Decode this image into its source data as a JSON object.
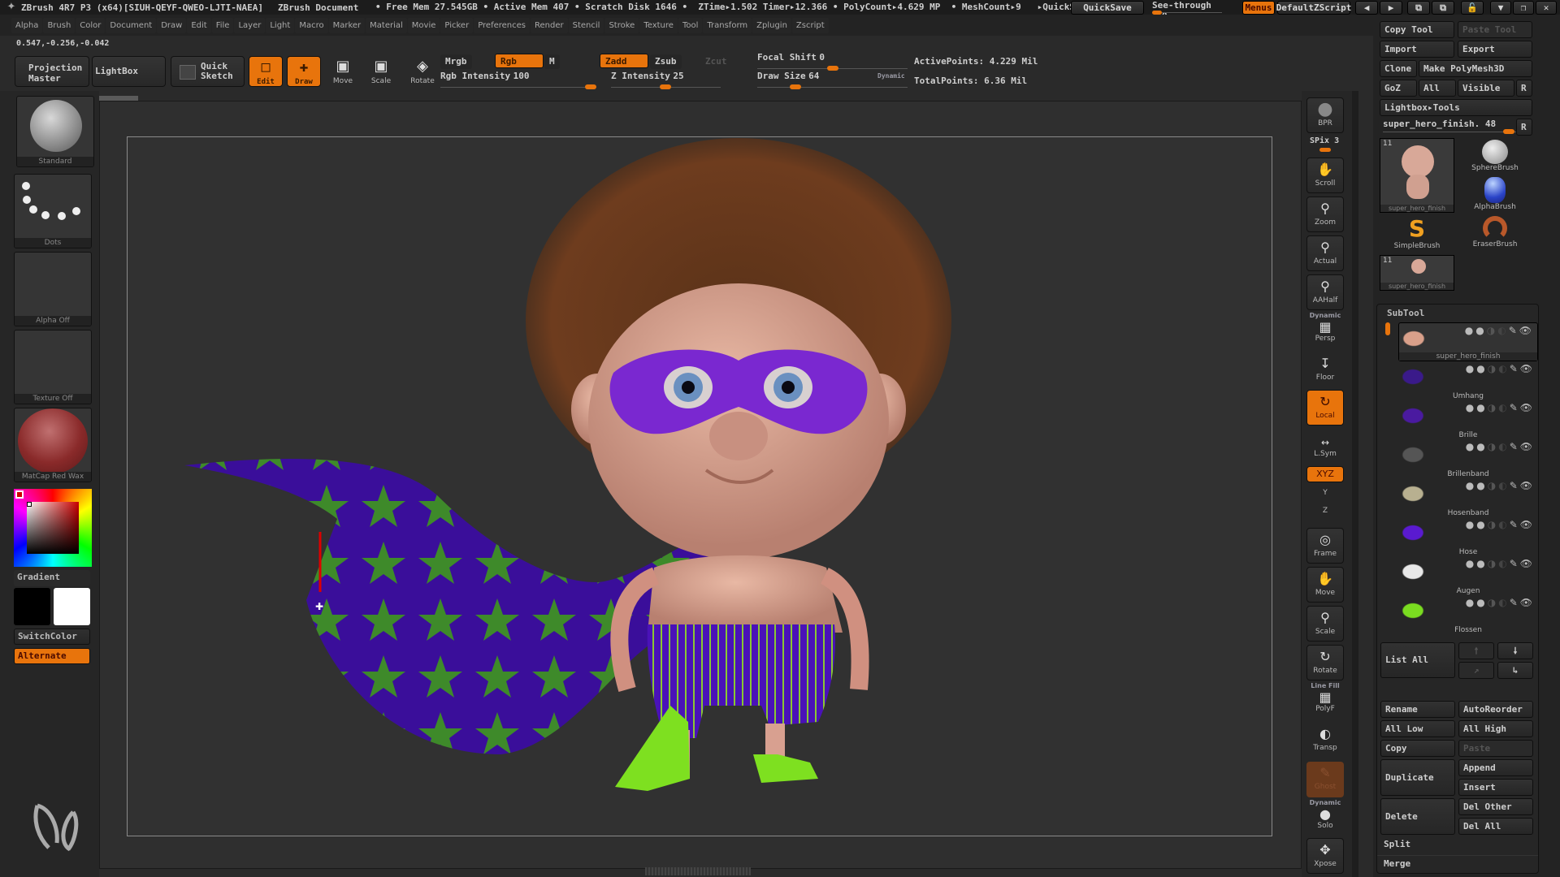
{
  "titlebar": {
    "app_title": "ZBrush 4R7 P3 (x64)[SIUH-QEYF-QWEO-LJTI-NAEA]",
    "document_title": "ZBrush Document",
    "info": "• Free Mem 27.545GB • Active Mem 407 • Scratch Disk 1646 •  ZTime▸1.502 Timer▸12.366 • PolyCount▸4.629 MP  • MeshCount▸9   ▸QuickS",
    "quicksave_label": "QuickSave",
    "seethrough_label": "See-through",
    "seethrough_value": "0",
    "seethrough_fraction": 0,
    "menus_label": "Menus",
    "default_zscript_label": "DefaultZScript"
  },
  "menubar": {
    "items": [
      "Alpha",
      "Brush",
      "Color",
      "Document",
      "Draw",
      "Edit",
      "File",
      "Layer",
      "Light",
      "Macro",
      "Marker",
      "Material",
      "Movie",
      "Picker",
      "Preferences",
      "Render",
      "Stencil",
      "Stroke",
      "Texture",
      "Tool",
      "Transform",
      "Zplugin",
      "Zscript"
    ]
  },
  "toolbar": {
    "coords": "0.547,-0.256,-0.042",
    "projection_master": "Projection\nMaster",
    "lightbox": "LightBox",
    "quick_sketch": "Quick\nSketch",
    "edit": "Edit",
    "draw": "Draw",
    "move": "Move",
    "scale": "Scale",
    "rotate": "Rotate",
    "mrgb": "Mrgb",
    "rgb": "Rgb",
    "m": "M",
    "rgb_intensity_label": "Rgb Intensity",
    "rgb_intensity": "100",
    "zadd": "Zadd",
    "zsub": "Zsub",
    "zcut": "Zcut",
    "z_intensity_label": "Z Intensity",
    "z_intensity": "25",
    "focal_shift_label": "Focal Shift",
    "focal_shift": "0",
    "draw_size_label": "Draw Size",
    "draw_size": "64",
    "dynamic": "Dynamic",
    "active_points": "ActivePoints: 4.229 Mil",
    "total_points": "TotalPoints: 6.36 Mil"
  },
  "left_shelf": {
    "brush": "Standard",
    "stroke": "Dots",
    "alpha": "Alpha Off",
    "texture": "Texture Off",
    "material": "MatCap Red Wax",
    "gradient": "Gradient",
    "switch_color": "SwitchColor",
    "alternate": "Alternate",
    "main_color": "#cc0000",
    "secondary_color": "#ffffff"
  },
  "right_shelf": {
    "bpr": "BPR",
    "spix": "SPix 3",
    "scroll": "Scroll",
    "zoom": "Zoom",
    "actual": "Actual",
    "aahalf": "AAHalf",
    "dynamic": "Dynamic",
    "persp": "Persp",
    "floor": "Floor",
    "local": "Local",
    "lsym": "L.Sym",
    "xyz": "XYZ",
    "y": "Y",
    "z": "Z",
    "frame": "Frame",
    "move": "Move",
    "scale": "Scale",
    "rotate": "Rotate",
    "line_fill": "Line Fill",
    "polyf": "PolyF",
    "transp": "Transp",
    "ghost": "Ghost",
    "solo_dynamic": "Dynamic",
    "solo": "Solo",
    "xpose": "Xpose"
  },
  "tool_palette": {
    "copy_tool": "Copy Tool",
    "paste_tool": "Paste Tool",
    "import": "Import",
    "export": "Export",
    "clone": "Clone",
    "make_polymesh": "Make PolyMesh3D",
    "goz": "GoZ",
    "all": "All",
    "visible": "Visible",
    "r": "R",
    "lightbox_tools": "Lightbox▸Tools",
    "current_tool": "super_hero_finish. 48",
    "current_tool_slider": 1.0,
    "tools": [
      {
        "name": "super_hero_finish",
        "count": "11"
      },
      {
        "name": "SphereBrush"
      },
      {
        "name": "AlphaBrush"
      },
      {
        "name": "SimpleBrush"
      },
      {
        "name": "EraserBrush"
      },
      {
        "name": "super_hero_finish",
        "count": "11"
      }
    ]
  },
  "subtool": {
    "title": "SubTool",
    "items": [
      {
        "name": "super_hero_finish",
        "selected": true,
        "color": "#d9a08a"
      },
      {
        "name": "Umhang",
        "selected": false,
        "color": "#3a1a8a"
      },
      {
        "name": "Brille",
        "selected": false,
        "color": "#4a1aa0"
      },
      {
        "name": "Brillenband",
        "selected": false,
        "color": "#555555"
      },
      {
        "name": "Hosenband",
        "selected": false,
        "color": "#b8b090"
      },
      {
        "name": "Hose",
        "selected": false,
        "color": "#5a1ad0"
      },
      {
        "name": "Augen",
        "selected": false,
        "color": "#e8e8e8"
      },
      {
        "name": "Flossen",
        "selected": false,
        "color": "#7adc20"
      }
    ],
    "list_all": "List All",
    "rename": "Rename",
    "auto_reorder": "AutoReorder",
    "all_low": "All Low",
    "all_high": "All High",
    "copy": "Copy",
    "paste": "Paste",
    "duplicate": "Duplicate",
    "append": "Append",
    "insert": "Insert",
    "delete": "Delete",
    "del_other": "Del Other",
    "del_all": "Del All",
    "split": "Split",
    "merge": "Merge"
  },
  "colors": {
    "accent": "#e8740c",
    "background": "#2a2a2a"
  }
}
